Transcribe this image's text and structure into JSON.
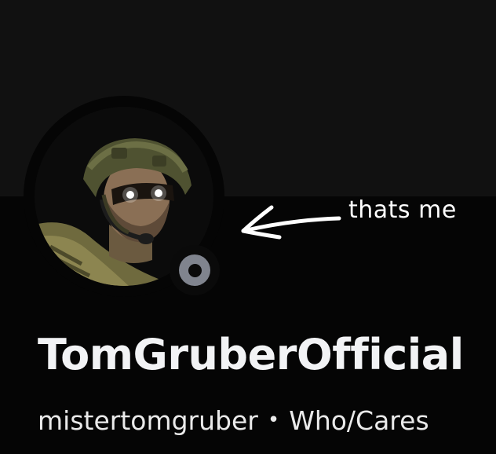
{
  "profile": {
    "display_name": "TomGruberOfficial",
    "username": "mistertomgruber",
    "separator": "•",
    "pronouns": "Who/Cares",
    "status": "offline",
    "avatar_icon": "soldier-avatar"
  },
  "annotation": {
    "text": "thats me",
    "arrow_icon": "arrow-left-icon"
  },
  "colors": {
    "banner": "#111111",
    "background": "#050505",
    "status_offline": "#80848e",
    "text": "#f2f3f5"
  }
}
